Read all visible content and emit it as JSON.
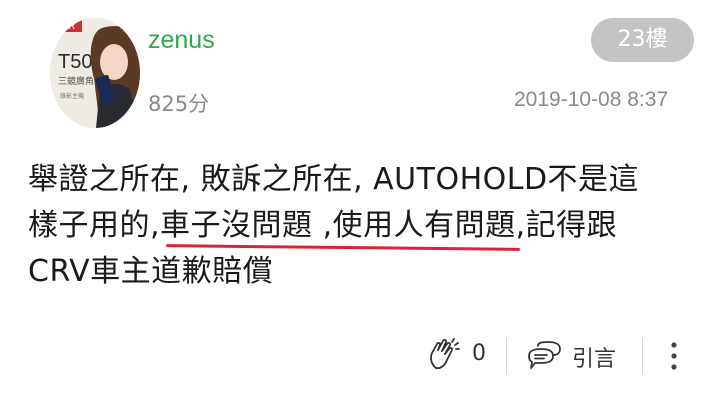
{
  "author": {
    "username": "zenus",
    "points": "825分",
    "avatar_logo_text": "T50",
    "avatar_caption_1": "三鏡廣角",
    "avatar_caption_2": "錄影主機"
  },
  "post": {
    "floor": "23樓",
    "timestamp": "2019-10-08 8:37",
    "line1": "舉證之所在, 敗訴之所在, AUTOHOLD不是這",
    "line2_start": "樣子用的,",
    "line2_underlined": "車子沒問題 ,使用人有問題",
    "line2_end": ",記得跟",
    "line3": "CRV車主道歉賠償",
    "underline_color": "#d8233b"
  },
  "actions": {
    "like_count": "0",
    "quote_label": "引言",
    "like_icon": "clapping-hands-icon",
    "quote_icon": "chat-bubble-icon",
    "more_icon": "vertical-dots-icon"
  },
  "colors": {
    "username": "#2fa84f",
    "meta_text": "#8a8a8a",
    "badge_bg": "#c4c4c4"
  }
}
